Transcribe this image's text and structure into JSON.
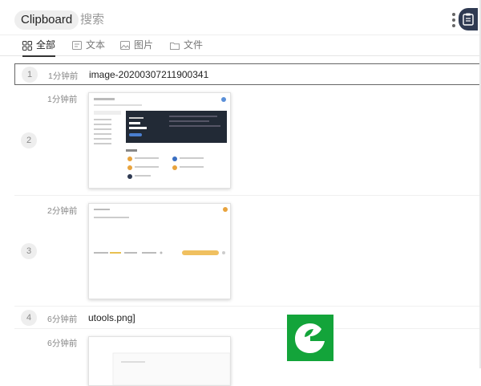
{
  "header": {
    "app_title": "Clipboard",
    "search_placeholder": "搜索"
  },
  "tabs": [
    {
      "label": "全部",
      "icon": "grid-icon",
      "active": true
    },
    {
      "label": "文本",
      "icon": "text-icon",
      "active": false
    },
    {
      "label": "图片",
      "icon": "image-icon",
      "active": false
    },
    {
      "label": "文件",
      "icon": "folder-icon",
      "active": false
    }
  ],
  "items": [
    {
      "index": "1",
      "time": "1分钟前",
      "type": "text",
      "text": "image-20200307211900341",
      "selected": true
    },
    {
      "index": "2",
      "time": "1分钟前",
      "type": "image"
    },
    {
      "index": "3",
      "time": "2分钟前",
      "type": "image"
    },
    {
      "index": "4",
      "time": "6分钟前",
      "type": "file",
      "text": "utools.png]"
    },
    {
      "index": "",
      "time": "6分钟前",
      "type": "image"
    }
  ],
  "colors": {
    "accent_dark": "#2f3a52",
    "logo_green": "#13a43a",
    "selected_border": "#666666"
  }
}
